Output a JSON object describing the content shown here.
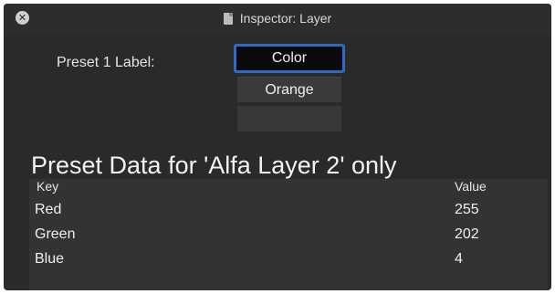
{
  "window": {
    "title": "Inspector: Layer",
    "icons": {
      "close": "close-icon",
      "document": "document-icon"
    }
  },
  "preset": {
    "label": "Preset 1 Label:",
    "fields": [
      "Color",
      "Orange",
      ""
    ]
  },
  "data_section": {
    "heading": "Preset Data for 'Alfa Layer 2' only",
    "columns": {
      "key": "Key",
      "value": "Value"
    },
    "rows": [
      {
        "key": "Red",
        "value": "255"
      },
      {
        "key": "Green",
        "value": "202"
      },
      {
        "key": "Blue",
        "value": "4"
      }
    ]
  },
  "colors": {
    "window_bg": "#2a2a2a",
    "focus_ring": "#2f6ac8",
    "table_bg": "#333333"
  }
}
